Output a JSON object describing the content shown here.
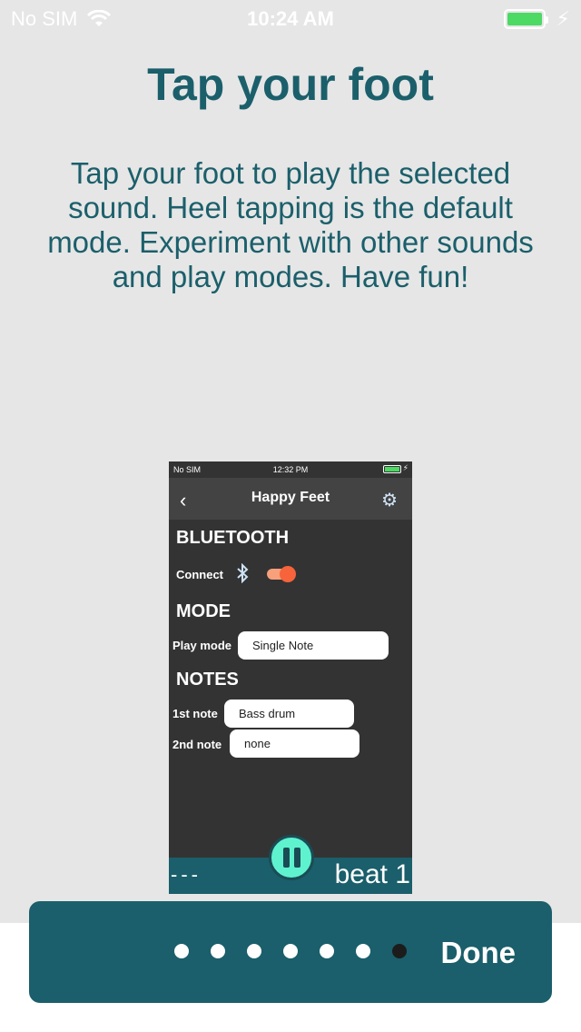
{
  "status_bar": {
    "carrier": "No SIM",
    "time": "10:24 AM",
    "battery_color": "#4cd964"
  },
  "onboarding": {
    "title": "Tap your foot",
    "description": "Tap your foot to play the selected sound.  Heel tapping is the default mode.  Experiment with other sounds and play modes. Have fun!"
  },
  "preview": {
    "status": {
      "carrier": "No SIM",
      "time": "12:32 PM"
    },
    "nav_title": "Happy Feet",
    "sections": {
      "bluetooth": "BLUETOOTH",
      "mode": "MODE",
      "notes": "NOTES"
    },
    "connect_label": "Connect",
    "toggle_on": true,
    "play_mode_label": "Play mode",
    "play_mode_value": "Single Note",
    "first_note_label": "1st note",
    "first_note_value": "Bass drum",
    "second_note_label": "2nd note",
    "second_note_value": "none",
    "beat_placeholder": "---",
    "beat_label": "beat 1"
  },
  "pager": {
    "page_count": 7,
    "current_page": 7,
    "done_label": "Done",
    "accent_color": "#1a5f6b"
  }
}
